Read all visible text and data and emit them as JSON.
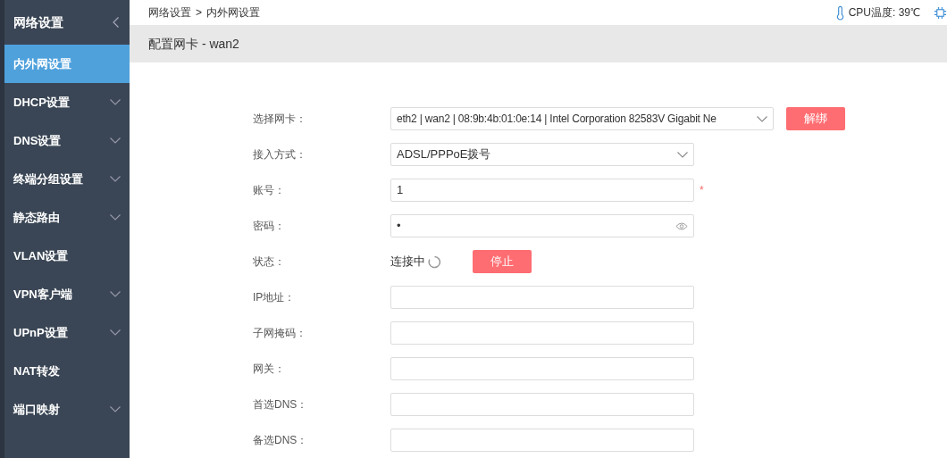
{
  "sidebar": {
    "title": "网络设置",
    "items": [
      {
        "label": "内外网设置",
        "selected": true,
        "expandable": false
      },
      {
        "label": "DHCP设置",
        "selected": false,
        "expandable": true
      },
      {
        "label": "DNS设置",
        "selected": false,
        "expandable": true
      },
      {
        "label": "终端分组设置",
        "selected": false,
        "expandable": true
      },
      {
        "label": "静态路由",
        "selected": false,
        "expandable": true
      },
      {
        "label": "VLAN设置",
        "selected": false,
        "expandable": false
      },
      {
        "label": "VPN客户端",
        "selected": false,
        "expandable": true
      },
      {
        "label": "UPnP设置",
        "selected": false,
        "expandable": true
      },
      {
        "label": "NAT转发",
        "selected": false,
        "expandable": false
      },
      {
        "label": "端口映射",
        "selected": false,
        "expandable": true
      }
    ]
  },
  "breadcrumb": {
    "items": [
      "网络设置",
      "内外网设置"
    ],
    "separator": ">"
  },
  "cpu_temperature": "CPU温度: 39℃",
  "panel_title": "配置网卡 - wan2",
  "form": [
    {
      "kind": "select",
      "label": "选择网卡：",
      "value": "eth2 | wan2 | 08:9b:4b:01:0e:14 | Intel Corporation 82583V Gigabit Ne",
      "wide": true,
      "button": "解绑"
    },
    {
      "kind": "select",
      "label": "接入方式：",
      "value": "ADSL/PPPoE拨号"
    },
    {
      "kind": "input",
      "label": "账号：",
      "value": "1",
      "required_mark": "*"
    },
    {
      "kind": "password",
      "label": "密码：",
      "value": "•"
    },
    {
      "kind": "status",
      "label": "状态：",
      "value": "连接中",
      "button": "停止"
    },
    {
      "kind": "input",
      "label": "IP地址："
    },
    {
      "kind": "input",
      "label": "子网掩码："
    },
    {
      "kind": "input",
      "label": "网关："
    },
    {
      "kind": "input",
      "label": "首选DNS："
    },
    {
      "kind": "input",
      "label": "备选DNS："
    }
  ]
}
